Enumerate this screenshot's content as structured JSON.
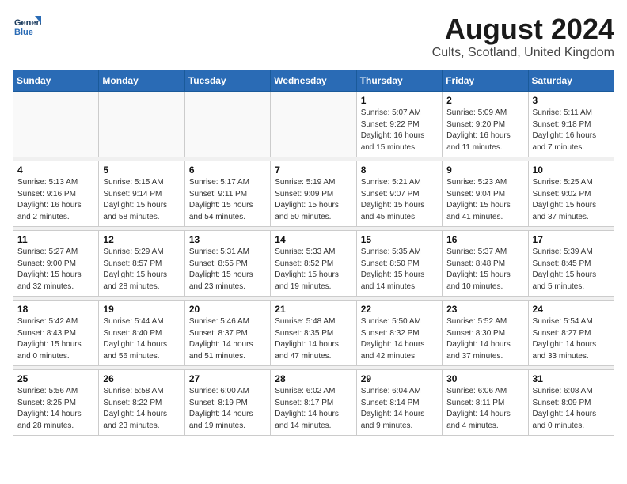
{
  "logo": {
    "line1": "General",
    "line2": "Blue"
  },
  "title": "August 2024",
  "subtitle": "Cults, Scotland, United Kingdom",
  "weekdays": [
    "Sunday",
    "Monday",
    "Tuesday",
    "Wednesday",
    "Thursday",
    "Friday",
    "Saturday"
  ],
  "weeks": [
    [
      {
        "day": "",
        "info": ""
      },
      {
        "day": "",
        "info": ""
      },
      {
        "day": "",
        "info": ""
      },
      {
        "day": "",
        "info": ""
      },
      {
        "day": "1",
        "info": "Sunrise: 5:07 AM\nSunset: 9:22 PM\nDaylight: 16 hours\nand 15 minutes."
      },
      {
        "day": "2",
        "info": "Sunrise: 5:09 AM\nSunset: 9:20 PM\nDaylight: 16 hours\nand 11 minutes."
      },
      {
        "day": "3",
        "info": "Sunrise: 5:11 AM\nSunset: 9:18 PM\nDaylight: 16 hours\nand 7 minutes."
      }
    ],
    [
      {
        "day": "4",
        "info": "Sunrise: 5:13 AM\nSunset: 9:16 PM\nDaylight: 16 hours\nand 2 minutes."
      },
      {
        "day": "5",
        "info": "Sunrise: 5:15 AM\nSunset: 9:14 PM\nDaylight: 15 hours\nand 58 minutes."
      },
      {
        "day": "6",
        "info": "Sunrise: 5:17 AM\nSunset: 9:11 PM\nDaylight: 15 hours\nand 54 minutes."
      },
      {
        "day": "7",
        "info": "Sunrise: 5:19 AM\nSunset: 9:09 PM\nDaylight: 15 hours\nand 50 minutes."
      },
      {
        "day": "8",
        "info": "Sunrise: 5:21 AM\nSunset: 9:07 PM\nDaylight: 15 hours\nand 45 minutes."
      },
      {
        "day": "9",
        "info": "Sunrise: 5:23 AM\nSunset: 9:04 PM\nDaylight: 15 hours\nand 41 minutes."
      },
      {
        "day": "10",
        "info": "Sunrise: 5:25 AM\nSunset: 9:02 PM\nDaylight: 15 hours\nand 37 minutes."
      }
    ],
    [
      {
        "day": "11",
        "info": "Sunrise: 5:27 AM\nSunset: 9:00 PM\nDaylight: 15 hours\nand 32 minutes."
      },
      {
        "day": "12",
        "info": "Sunrise: 5:29 AM\nSunset: 8:57 PM\nDaylight: 15 hours\nand 28 minutes."
      },
      {
        "day": "13",
        "info": "Sunrise: 5:31 AM\nSunset: 8:55 PM\nDaylight: 15 hours\nand 23 minutes."
      },
      {
        "day": "14",
        "info": "Sunrise: 5:33 AM\nSunset: 8:52 PM\nDaylight: 15 hours\nand 19 minutes."
      },
      {
        "day": "15",
        "info": "Sunrise: 5:35 AM\nSunset: 8:50 PM\nDaylight: 15 hours\nand 14 minutes."
      },
      {
        "day": "16",
        "info": "Sunrise: 5:37 AM\nSunset: 8:48 PM\nDaylight: 15 hours\nand 10 minutes."
      },
      {
        "day": "17",
        "info": "Sunrise: 5:39 AM\nSunset: 8:45 PM\nDaylight: 15 hours\nand 5 minutes."
      }
    ],
    [
      {
        "day": "18",
        "info": "Sunrise: 5:42 AM\nSunset: 8:43 PM\nDaylight: 15 hours\nand 0 minutes."
      },
      {
        "day": "19",
        "info": "Sunrise: 5:44 AM\nSunset: 8:40 PM\nDaylight: 14 hours\nand 56 minutes."
      },
      {
        "day": "20",
        "info": "Sunrise: 5:46 AM\nSunset: 8:37 PM\nDaylight: 14 hours\nand 51 minutes."
      },
      {
        "day": "21",
        "info": "Sunrise: 5:48 AM\nSunset: 8:35 PM\nDaylight: 14 hours\nand 47 minutes."
      },
      {
        "day": "22",
        "info": "Sunrise: 5:50 AM\nSunset: 8:32 PM\nDaylight: 14 hours\nand 42 minutes."
      },
      {
        "day": "23",
        "info": "Sunrise: 5:52 AM\nSunset: 8:30 PM\nDaylight: 14 hours\nand 37 minutes."
      },
      {
        "day": "24",
        "info": "Sunrise: 5:54 AM\nSunset: 8:27 PM\nDaylight: 14 hours\nand 33 minutes."
      }
    ],
    [
      {
        "day": "25",
        "info": "Sunrise: 5:56 AM\nSunset: 8:25 PM\nDaylight: 14 hours\nand 28 minutes."
      },
      {
        "day": "26",
        "info": "Sunrise: 5:58 AM\nSunset: 8:22 PM\nDaylight: 14 hours\nand 23 minutes."
      },
      {
        "day": "27",
        "info": "Sunrise: 6:00 AM\nSunset: 8:19 PM\nDaylight: 14 hours\nand 19 minutes."
      },
      {
        "day": "28",
        "info": "Sunrise: 6:02 AM\nSunset: 8:17 PM\nDaylight: 14 hours\nand 14 minutes."
      },
      {
        "day": "29",
        "info": "Sunrise: 6:04 AM\nSunset: 8:14 PM\nDaylight: 14 hours\nand 9 minutes."
      },
      {
        "day": "30",
        "info": "Sunrise: 6:06 AM\nSunset: 8:11 PM\nDaylight: 14 hours\nand 4 minutes."
      },
      {
        "day": "31",
        "info": "Sunrise: 6:08 AM\nSunset: 8:09 PM\nDaylight: 14 hours\nand 0 minutes."
      }
    ]
  ]
}
